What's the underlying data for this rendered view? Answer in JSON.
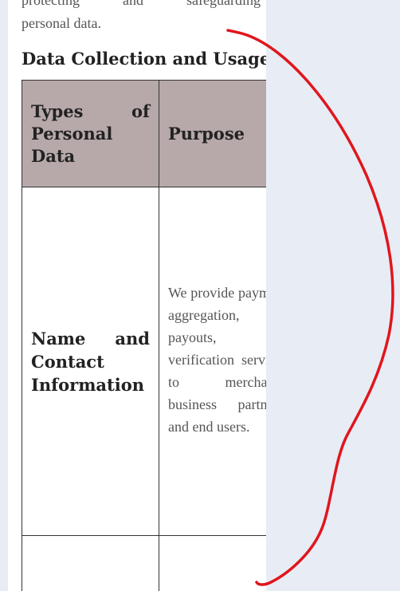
{
  "intro": {
    "line1": "protecting and safeguarding",
    "line2": "personal data."
  },
  "section": {
    "title": "Data Collection and Usage"
  },
  "table": {
    "headers": [
      "Types of Personal Data",
      "Purpose"
    ],
    "rows": [
      {
        "type": "Name and Contact Information",
        "purpose": "We provide payment aggregation, payouts, and verification services to merchants, business partners, and end users."
      },
      {
        "type": "",
        "purpose": ""
      }
    ]
  },
  "annotation": {
    "kind": "hand-drawn-bracket",
    "color": "#e0161c"
  }
}
